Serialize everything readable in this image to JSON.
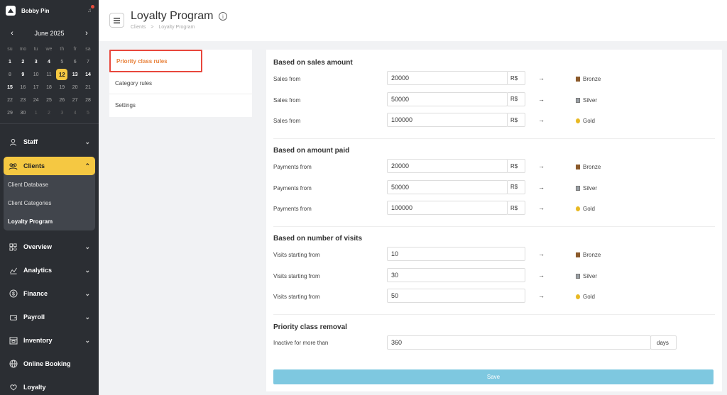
{
  "user": {
    "name": "Bobby Pin"
  },
  "calendar": {
    "month": "June 2025",
    "dow": [
      "su",
      "mo",
      "tu",
      "we",
      "th",
      "fr",
      "sa"
    ],
    "days": [
      {
        "d": "1",
        "s": "bold"
      },
      {
        "d": "2",
        "s": "bold"
      },
      {
        "d": "3",
        "s": "bold"
      },
      {
        "d": "4",
        "s": "bold"
      },
      {
        "d": "5",
        "s": "dim"
      },
      {
        "d": "6",
        "s": "dim"
      },
      {
        "d": "7",
        "s": "dim"
      },
      {
        "d": "8",
        "s": "dim"
      },
      {
        "d": "9",
        "s": "bold"
      },
      {
        "d": "10",
        "s": "dim"
      },
      {
        "d": "11",
        "s": "dim"
      },
      {
        "d": "12",
        "s": "today"
      },
      {
        "d": "13",
        "s": "bold"
      },
      {
        "d": "14",
        "s": "bold"
      },
      {
        "d": "15",
        "s": "bold"
      },
      {
        "d": "16",
        "s": "dim"
      },
      {
        "d": "17",
        "s": "dim"
      },
      {
        "d": "18",
        "s": "dim"
      },
      {
        "d": "19",
        "s": "dim"
      },
      {
        "d": "20",
        "s": "dim"
      },
      {
        "d": "21",
        "s": "dim"
      },
      {
        "d": "22",
        "s": "dim"
      },
      {
        "d": "23",
        "s": "dim"
      },
      {
        "d": "24",
        "s": "dim"
      },
      {
        "d": "25",
        "s": "dim"
      },
      {
        "d": "26",
        "s": "dim"
      },
      {
        "d": "27",
        "s": "dim"
      },
      {
        "d": "28",
        "s": "dim"
      },
      {
        "d": "29",
        "s": "dim"
      },
      {
        "d": "30",
        "s": "dim"
      },
      {
        "d": "1",
        "s": "out"
      },
      {
        "d": "2",
        "s": "out"
      },
      {
        "d": "3",
        "s": "out"
      },
      {
        "d": "4",
        "s": "out"
      },
      {
        "d": "5",
        "s": "out"
      }
    ]
  },
  "nav": {
    "staff": "Staff",
    "clients": "Clients",
    "client_database": "Client Database",
    "client_categories": "Client Categories",
    "loyalty_program": "Loyalty Program",
    "overview": "Overview",
    "analytics": "Analytics",
    "finance": "Finance",
    "payroll": "Payroll",
    "inventory": "Inventory",
    "online_booking": "Online Booking",
    "loyalty": "Loyalty"
  },
  "header": {
    "title": "Loyalty Program",
    "breadcrumb": [
      "Clients",
      "Loyalty Program"
    ],
    "breadcrumb_sep": ">"
  },
  "tabs": [
    "Priority class rules",
    "Category rules",
    "Settings"
  ],
  "sections": {
    "sales": {
      "title": "Based on sales amount",
      "rows": [
        {
          "label": "Sales from",
          "value": "20000",
          "unit": "R$",
          "tier": "Bronze"
        },
        {
          "label": "Sales from",
          "value": "50000",
          "unit": "R$",
          "tier": "Silver"
        },
        {
          "label": "Sales from",
          "value": "100000",
          "unit": "R$",
          "tier": "Gold"
        }
      ]
    },
    "paid": {
      "title": "Based on amount paid",
      "rows": [
        {
          "label": "Payments from",
          "value": "20000",
          "unit": "R$",
          "tier": "Bronze"
        },
        {
          "label": "Payments from",
          "value": "50000",
          "unit": "R$",
          "tier": "Silver"
        },
        {
          "label": "Payments from",
          "value": "100000",
          "unit": "R$",
          "tier": "Gold"
        }
      ]
    },
    "visits": {
      "title": "Based on number of visits",
      "rows": [
        {
          "label": "Visits starting from",
          "value": "10",
          "tier": "Bronze"
        },
        {
          "label": "Visits starting from",
          "value": "30",
          "tier": "Silver"
        },
        {
          "label": "Visits starting from",
          "value": "50",
          "tier": "Gold"
        }
      ]
    },
    "removal": {
      "title": "Priority class removal",
      "label": "Inactive for more than",
      "value": "360",
      "unit": "days"
    }
  },
  "arrow": "→",
  "save_label": "Save",
  "colors": {
    "accent": "#f5c842",
    "save": "#7ec8e0",
    "active_tab": "#e8823c",
    "highlight_border": "#e8473c"
  }
}
